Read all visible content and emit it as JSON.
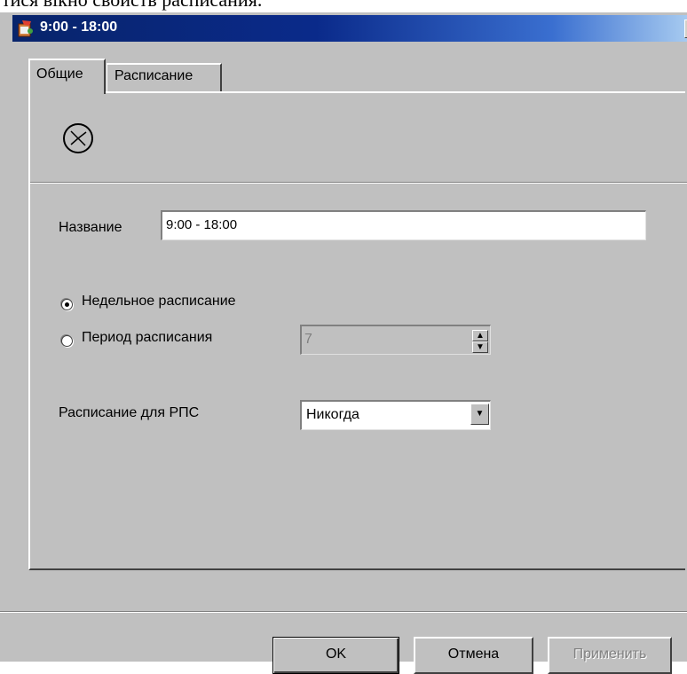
{
  "caption": "тися вікно свойств расписания.",
  "window": {
    "title": "9:00 - 18:00",
    "close_label": "X"
  },
  "tabs": [
    {
      "label": "Общие",
      "active": true
    },
    {
      "label": "Расписание",
      "active": false
    }
  ],
  "form": {
    "name_label": "Название",
    "name_value": "9:00 - 18:00",
    "radio_weekly_label": "Недельное расписание",
    "radio_weekly_selected": true,
    "radio_period_label": "Период расписания",
    "radio_period_selected": false,
    "period_value": "7",
    "rps_label": "Расписание для РПС",
    "rps_value": "Никогда"
  },
  "buttons": {
    "ok": "OK",
    "cancel": "Отмена",
    "apply": "Применить"
  },
  "icons": {
    "app": "schedule-app-icon",
    "tab_content": "clock-icon"
  },
  "colors": {
    "titlebar_start": "#08246b",
    "titlebar_end": "#a6caf0",
    "dialog_face": "#c0c0c0"
  }
}
